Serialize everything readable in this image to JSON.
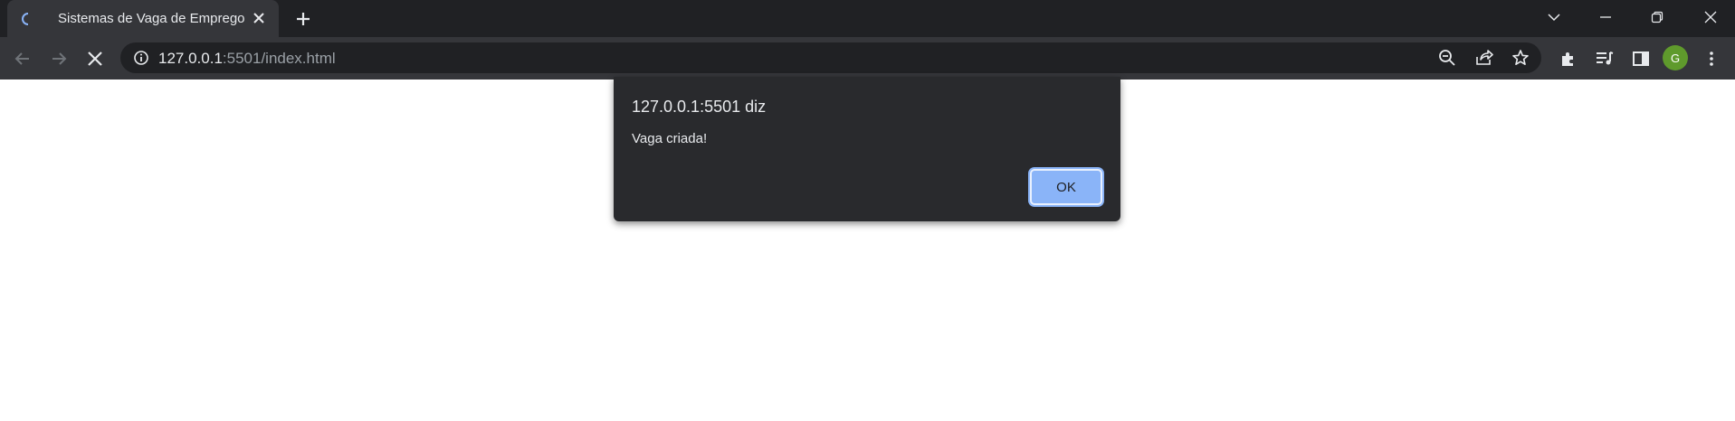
{
  "browser": {
    "tab": {
      "title": "Sistemas de Vaga de Emprego"
    },
    "url": {
      "host": "127.0.0.1",
      "rest": ":5501/index.html"
    },
    "profile_initial": "G"
  },
  "dialog": {
    "title": "127.0.0.1:5501 diz",
    "message": "Vaga criada!",
    "ok_label": "OK"
  },
  "colors": {
    "accent": "#8ab4f8",
    "tabstrip": "#202124",
    "toolbar": "#35363a",
    "avatar": "#5f9a2c"
  },
  "icons": [
    "loading-favicon-icon",
    "close-icon",
    "plus-icon",
    "chevron-down-icon",
    "minimize-icon",
    "restore-icon",
    "back-icon",
    "forward-icon",
    "stop-icon",
    "info-icon",
    "zoom-out-icon",
    "share-icon",
    "star-icon",
    "extensions-icon",
    "media-icon",
    "side-panel-icon",
    "more-icon"
  ]
}
